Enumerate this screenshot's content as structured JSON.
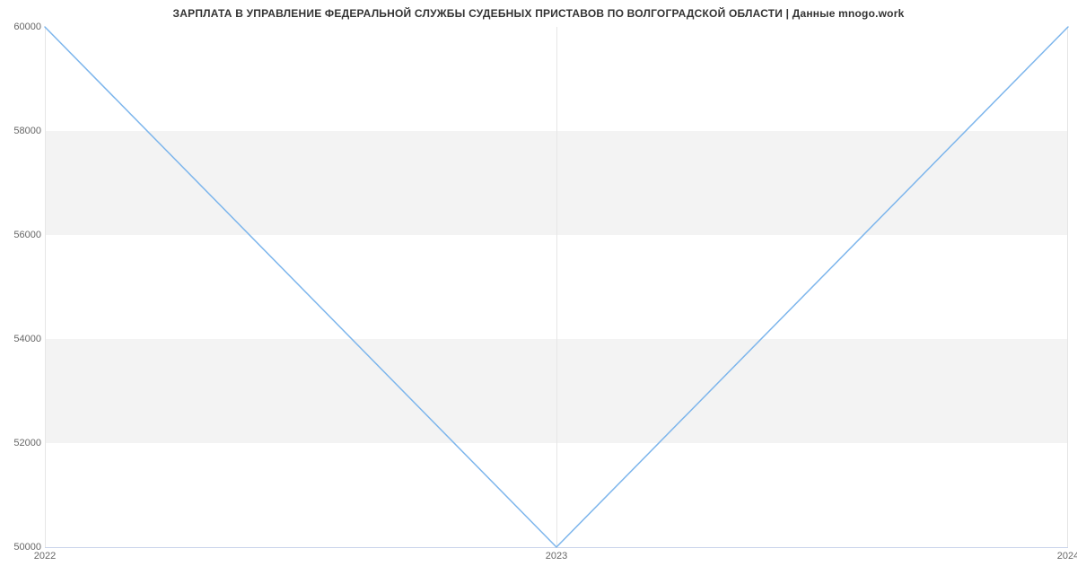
{
  "chart_data": {
    "type": "line",
    "title": "ЗАРПЛАТА В УПРАВЛЕНИЕ ФЕДЕРАЛЬНОЙ СЛУЖБЫ СУДЕБНЫХ ПРИСТАВОВ ПО ВОЛГОГРАДСКОЙ ОБЛАСТИ | Данные mnogo.work",
    "x": [
      2022,
      2023,
      2024
    ],
    "values": [
      60000,
      50000,
      60000
    ],
    "xlabel": "",
    "ylabel": "",
    "ylim": [
      50000,
      60000
    ],
    "y_ticks": [
      50000,
      52000,
      54000,
      56000,
      58000,
      60000
    ],
    "x_ticks": [
      2022,
      2023,
      2024
    ],
    "series_color": "#7cb5ec",
    "band_color": "#f3f3f3"
  }
}
